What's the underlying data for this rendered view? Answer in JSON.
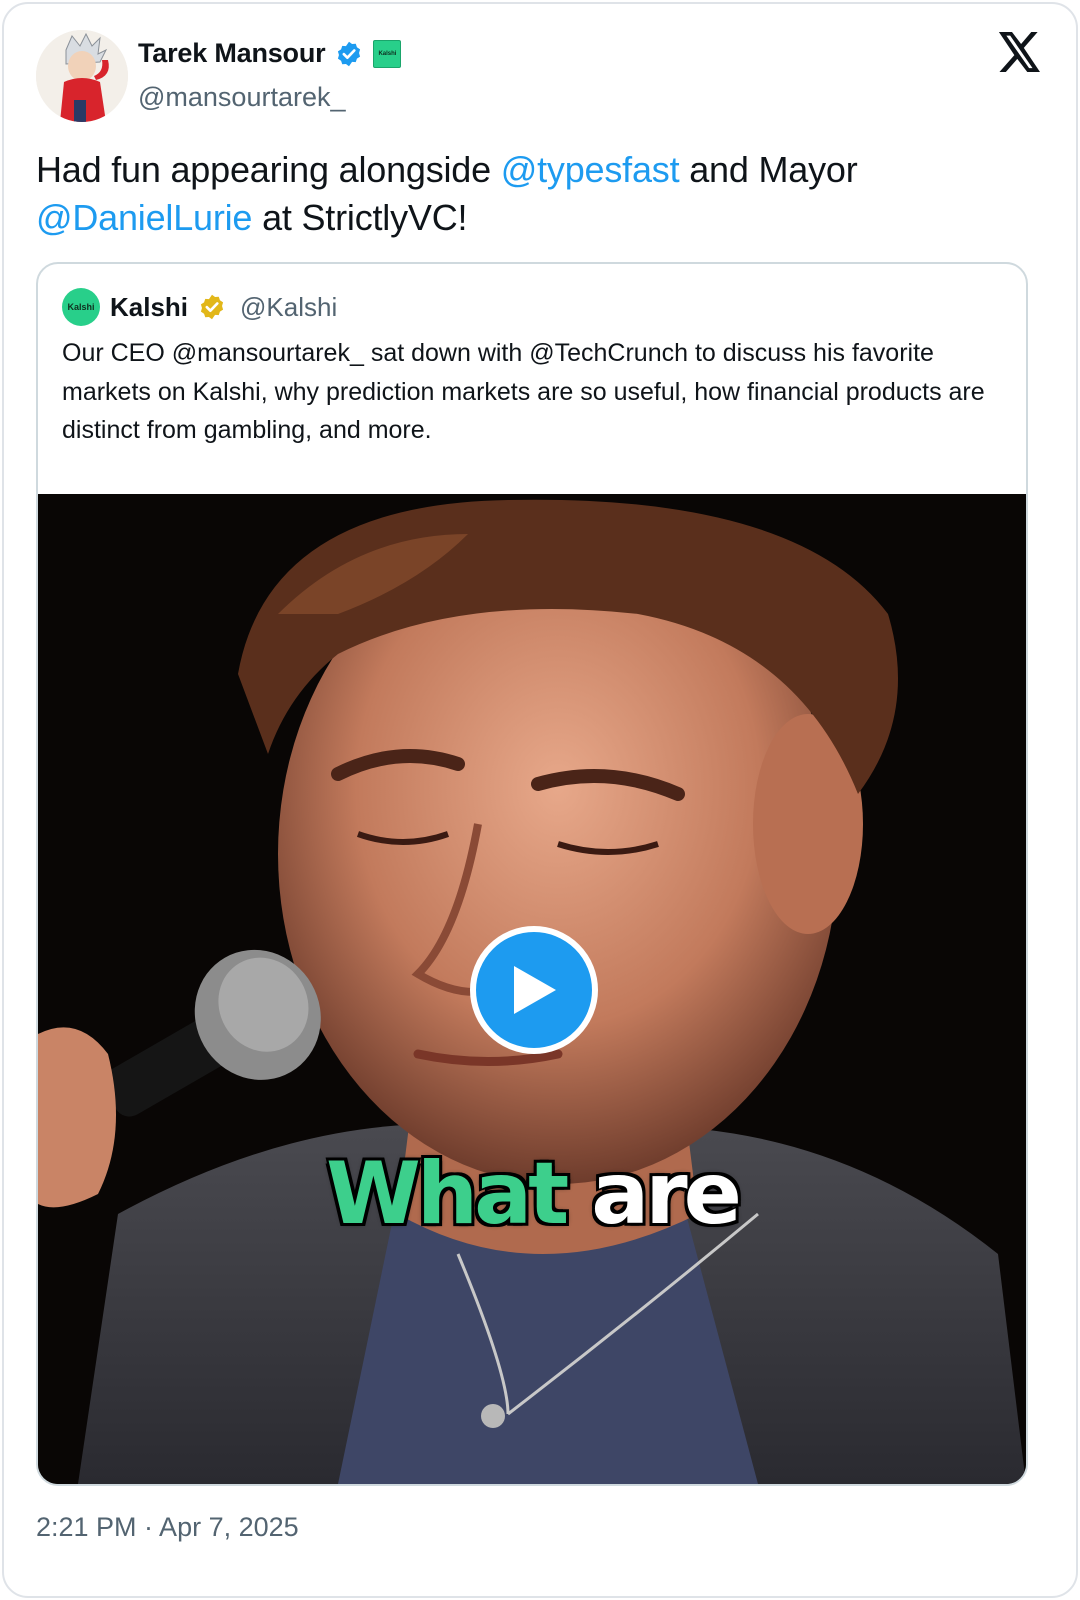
{
  "author": {
    "name": "Tarek Mansour",
    "handle": "@mansourtarek_",
    "affiliate_badge_text": "Kalshi"
  },
  "tweet": {
    "text_1": "Had fun appearing alongside ",
    "mention_1": "@typesfast",
    "text_2": " and Mayor ",
    "mention_2": "@DanielLurie",
    "text_3": " at StrictlyVC!"
  },
  "quoted": {
    "avatar_text": "Kalshi",
    "name": "Kalshi",
    "handle": "@Kalshi",
    "text": "Our CEO @mansourtarek_ sat down with @TechCrunch to discuss his favorite markets on Kalshi, why prediction markets are so useful, how financial products are distinct from gambling, and more.",
    "video_caption_green": "What",
    "video_caption_white": "are"
  },
  "timestamp": "2:21 PM · Apr 7, 2025",
  "colors": {
    "link": "#1d9bf0",
    "verified_blue": "#1d9bf0",
    "verified_gold": "#e2b719",
    "kalshi_green": "#28cf8a",
    "caption_green": "#3dcf8c"
  },
  "icons": {
    "platform": "x-logo-icon",
    "verified": "verified-badge-icon",
    "play": "play-icon"
  }
}
